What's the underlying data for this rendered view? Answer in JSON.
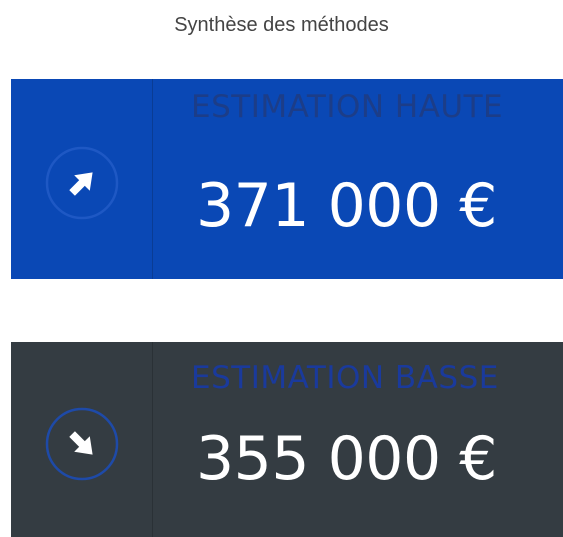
{
  "title": "Synthèse des méthodes",
  "colors": {
    "high_bg": "#0a48b5",
    "high_divider": "#0a3c94",
    "high_label": "#1c3d88",
    "low_bg": "#343c42",
    "low_divider": "#2a3136",
    "low_label": "#1a3a9c",
    "value_text": "#ffffff",
    "icon_border": "#1e58c4",
    "low_icon_border": "#1e4aa8"
  },
  "estimates": [
    {
      "label": "ESTIMATION HAUTE",
      "value": "371 000 €",
      "icon": "arrow-up-right-icon"
    },
    {
      "label": "ESTIMATION BASSE",
      "value": "355 000 €",
      "icon": "arrow-down-right-icon"
    }
  ]
}
